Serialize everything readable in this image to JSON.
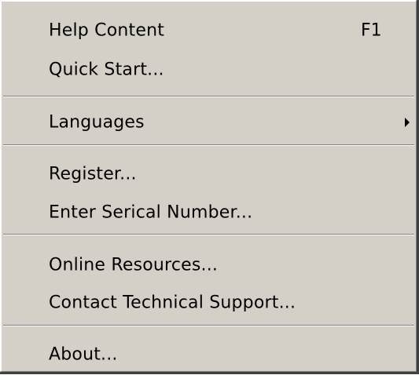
{
  "menu": {
    "items": [
      {
        "label": "Help Content",
        "shortcut": "F1"
      },
      {
        "label": "Quick Start..."
      },
      {
        "label": "Languages",
        "has_submenu": true
      },
      {
        "label": "Register..."
      },
      {
        "label": "Enter Serical Number..."
      },
      {
        "label": "Online Resources..."
      },
      {
        "label": "Contact Technical Support..."
      },
      {
        "label": "About..."
      }
    ]
  },
  "colors": {
    "menu_background": "#d4d0c8",
    "separator_dark": "#808080",
    "separator_light": "#ffffff",
    "text": "#000000"
  },
  "icons": {
    "submenu_arrow": "triangle-right-icon"
  }
}
